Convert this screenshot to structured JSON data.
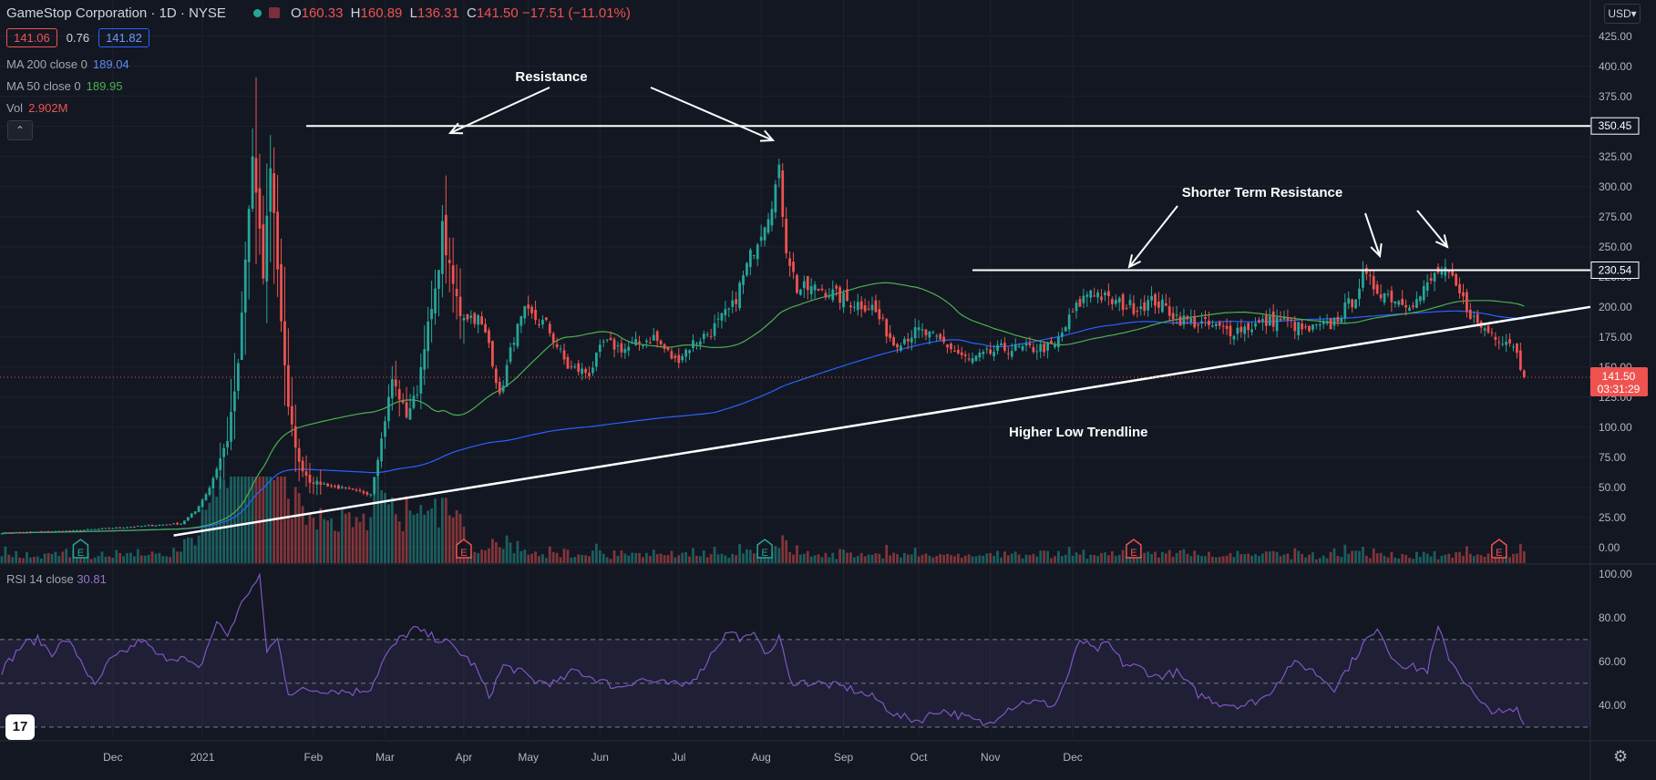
{
  "header": {
    "symbol": "GameStop Corporation · 1D · NYSE",
    "open_k": "O",
    "open": "160.33",
    "high_k": "H",
    "high": "160.89",
    "low_k": "L",
    "low": "136.31",
    "close_k": "C",
    "close": "141.50",
    "change": "−17.51 (−11.01%)",
    "bid": "141.06",
    "spread": "0.76",
    "ask": "141.82"
  },
  "indicators": {
    "ma200": {
      "name": "MA 200 close 0",
      "value": "189.04",
      "color": "#2962ff"
    },
    "ma50": {
      "name": "MA 50 close 0",
      "value": "189.95",
      "color": "#4caf50"
    },
    "vol": {
      "name": "Vol",
      "value": "2.902M",
      "color": "#ef5350"
    },
    "rsi": {
      "name": "RSI 14 close",
      "value": "30.81",
      "color": "#7e57c2"
    }
  },
  "toolbar": {
    "currency": "USD",
    "collapse_icon": "chevron-up-icon",
    "settings_icon": "gear-icon",
    "logo": "17"
  },
  "colors": {
    "up": "#26a69a",
    "down": "#ef5350",
    "background": "#131722",
    "grid": "#1e222d",
    "trend": "#ffffff",
    "rsi": "#7e57c2"
  },
  "chart_data": {
    "type": "candlestick",
    "xaxis_ticks": [
      "Dec",
      "2021",
      "Feb",
      "Mar",
      "Apr",
      "May",
      "Jun",
      "Jul",
      "Aug",
      "Sep",
      "Oct",
      "Nov",
      "Dec"
    ],
    "price_axis": {
      "ticks": [
        0,
        25,
        50,
        75,
        100,
        125,
        150,
        175,
        200,
        225,
        250,
        275,
        300,
        325,
        350,
        375,
        400,
        425
      ],
      "range": [
        -13,
        440
      ]
    },
    "rsi_axis": {
      "ticks": [
        40,
        60,
        80,
        100
      ],
      "band": [
        30,
        70
      ],
      "mid": 50,
      "range": [
        25,
        102
      ]
    },
    "price_labels": [
      {
        "value": 350.45,
        "text": "350.45"
      },
      {
        "value": 230.54,
        "text": "230.54"
      }
    ],
    "last_price": {
      "value": 141.5,
      "text": "141.50",
      "countdown": "03:31:29"
    },
    "annotations": [
      {
        "text": "Resistance"
      },
      {
        "text": "Shorter Term Resistance"
      },
      {
        "text": "Higher Low Trendline"
      }
    ],
    "horizontal_levels": [
      {
        "value": 350.45,
        "from_day": 85,
        "to_day": 441,
        "name": "resistance"
      },
      {
        "value": 230.54,
        "from_day": 271,
        "to_day": 441,
        "name": "shorter-term-resistance"
      }
    ],
    "trendline": {
      "from": {
        "day": 48,
        "value": 10
      },
      "to": {
        "day": 441,
        "value": 200
      }
    },
    "earnings_days": [
      22,
      129,
      213,
      316,
      418
    ],
    "price_keyframes": [
      [
        0,
        12
      ],
      [
        20,
        14
      ],
      [
        40,
        18
      ],
      [
        50,
        20
      ],
      [
        54,
        30
      ],
      [
        58,
        50
      ],
      [
        63,
        90
      ],
      [
        66,
        150
      ],
      [
        70,
        325
      ],
      [
        73,
        225
      ],
      [
        75,
        320
      ],
      [
        78,
        190
      ],
      [
        80,
        115
      ],
      [
        83,
        70
      ],
      [
        86,
        55
      ],
      [
        91,
        52
      ],
      [
        98,
        47
      ],
      [
        103,
        45
      ],
      [
        106,
        90
      ],
      [
        109,
        140
      ],
      [
        113,
        110
      ],
      [
        116,
        130
      ],
      [
        118,
        170
      ],
      [
        121,
        210
      ],
      [
        123,
        265
      ],
      [
        125,
        230
      ],
      [
        128,
        195
      ],
      [
        133,
        190
      ],
      [
        136,
        170
      ],
      [
        139,
        125
      ],
      [
        143,
        175
      ],
      [
        146,
        195
      ],
      [
        152,
        185
      ],
      [
        158,
        150
      ],
      [
        164,
        145
      ],
      [
        168,
        170
      ],
      [
        174,
        165
      ],
      [
        182,
        175
      ],
      [
        188,
        155
      ],
      [
        193,
        170
      ],
      [
        198,
        180
      ],
      [
        204,
        200
      ],
      [
        210,
        250
      ],
      [
        214,
        280
      ],
      [
        217,
        310
      ],
      [
        219,
        250
      ],
      [
        222,
        215
      ],
      [
        229,
        215
      ],
      [
        236,
        205
      ],
      [
        243,
        200
      ],
      [
        249,
        170
      ],
      [
        256,
        180
      ],
      [
        263,
        170
      ],
      [
        270,
        155
      ],
      [
        279,
        165
      ],
      [
        286,
        165
      ],
      [
        294,
        167
      ],
      [
        299,
        195
      ],
      [
        304,
        215
      ],
      [
        309,
        205
      ],
      [
        316,
        200
      ],
      [
        322,
        205
      ],
      [
        329,
        190
      ],
      [
        336,
        185
      ],
      [
        343,
        180
      ],
      [
        350,
        185
      ],
      [
        357,
        190
      ],
      [
        364,
        180
      ],
      [
        371,
        185
      ],
      [
        377,
        205
      ],
      [
        380,
        225
      ],
      [
        384,
        215
      ],
      [
        390,
        205
      ],
      [
        395,
        205
      ],
      [
        401,
        230
      ],
      [
        404,
        225
      ],
      [
        408,
        205
      ],
      [
        412,
        185
      ],
      [
        418,
        175
      ],
      [
        422,
        170
      ],
      [
        425,
        141.5
      ]
    ],
    "rsi_keyframes": [
      [
        0,
        56
      ],
      [
        3,
        62
      ],
      [
        6,
        68
      ],
      [
        10,
        70
      ],
      [
        14,
        64
      ],
      [
        18,
        70
      ],
      [
        22,
        61
      ],
      [
        26,
        48
      ],
      [
        30,
        60
      ],
      [
        34,
        64
      ],
      [
        39,
        70
      ],
      [
        44,
        62
      ],
      [
        50,
        62
      ],
      [
        55,
        56
      ],
      [
        60,
        78
      ],
      [
        63,
        72
      ],
      [
        68,
        90
      ],
      [
        72,
        98
      ],
      [
        74,
        65
      ],
      [
        77,
        70
      ],
      [
        80,
        46
      ],
      [
        86,
        47
      ],
      [
        92,
        47
      ],
      [
        98,
        46
      ],
      [
        103,
        48
      ],
      [
        107,
        62
      ],
      [
        111,
        70
      ],
      [
        115,
        75
      ],
      [
        119,
        72
      ],
      [
        124,
        69
      ],
      [
        128,
        64
      ],
      [
        132,
        58
      ],
      [
        136,
        44
      ],
      [
        140,
        58
      ],
      [
        144,
        56
      ],
      [
        149,
        51
      ],
      [
        155,
        50
      ],
      [
        160,
        56
      ],
      [
        166,
        52
      ],
      [
        172,
        48
      ],
      [
        178,
        52
      ],
      [
        184,
        50
      ],
      [
        190,
        49
      ],
      [
        195,
        55
      ],
      [
        199,
        66
      ],
      [
        203,
        74
      ],
      [
        207,
        70
      ],
      [
        211,
        72
      ],
      [
        214,
        62
      ],
      [
        217,
        72
      ],
      [
        220,
        51
      ],
      [
        228,
        50
      ],
      [
        236,
        48
      ],
      [
        244,
        43
      ],
      [
        250,
        35
      ],
      [
        256,
        33
      ],
      [
        262,
        38
      ],
      [
        268,
        35
      ],
      [
        275,
        31
      ],
      [
        280,
        38
      ],
      [
        286,
        42
      ],
      [
        294,
        40
      ],
      [
        298,
        55
      ],
      [
        301,
        70
      ],
      [
        305,
        65
      ],
      [
        309,
        68
      ],
      [
        313,
        59
      ],
      [
        318,
        57
      ],
      [
        322,
        53
      ],
      [
        328,
        55
      ],
      [
        334,
        45
      ],
      [
        340,
        41
      ],
      [
        347,
        40
      ],
      [
        353,
        44
      ],
      [
        360,
        59
      ],
      [
        365,
        57
      ],
      [
        372,
        48
      ],
      [
        377,
        60
      ],
      [
        381,
        70
      ],
      [
        385,
        74
      ],
      [
        388,
        62
      ],
      [
        392,
        58
      ],
      [
        398,
        56
      ],
      [
        401,
        75
      ],
      [
        404,
        62
      ],
      [
        408,
        52
      ],
      [
        413,
        40
      ],
      [
        419,
        36
      ],
      [
        423,
        38
      ],
      [
        425,
        31
      ]
    ]
  }
}
